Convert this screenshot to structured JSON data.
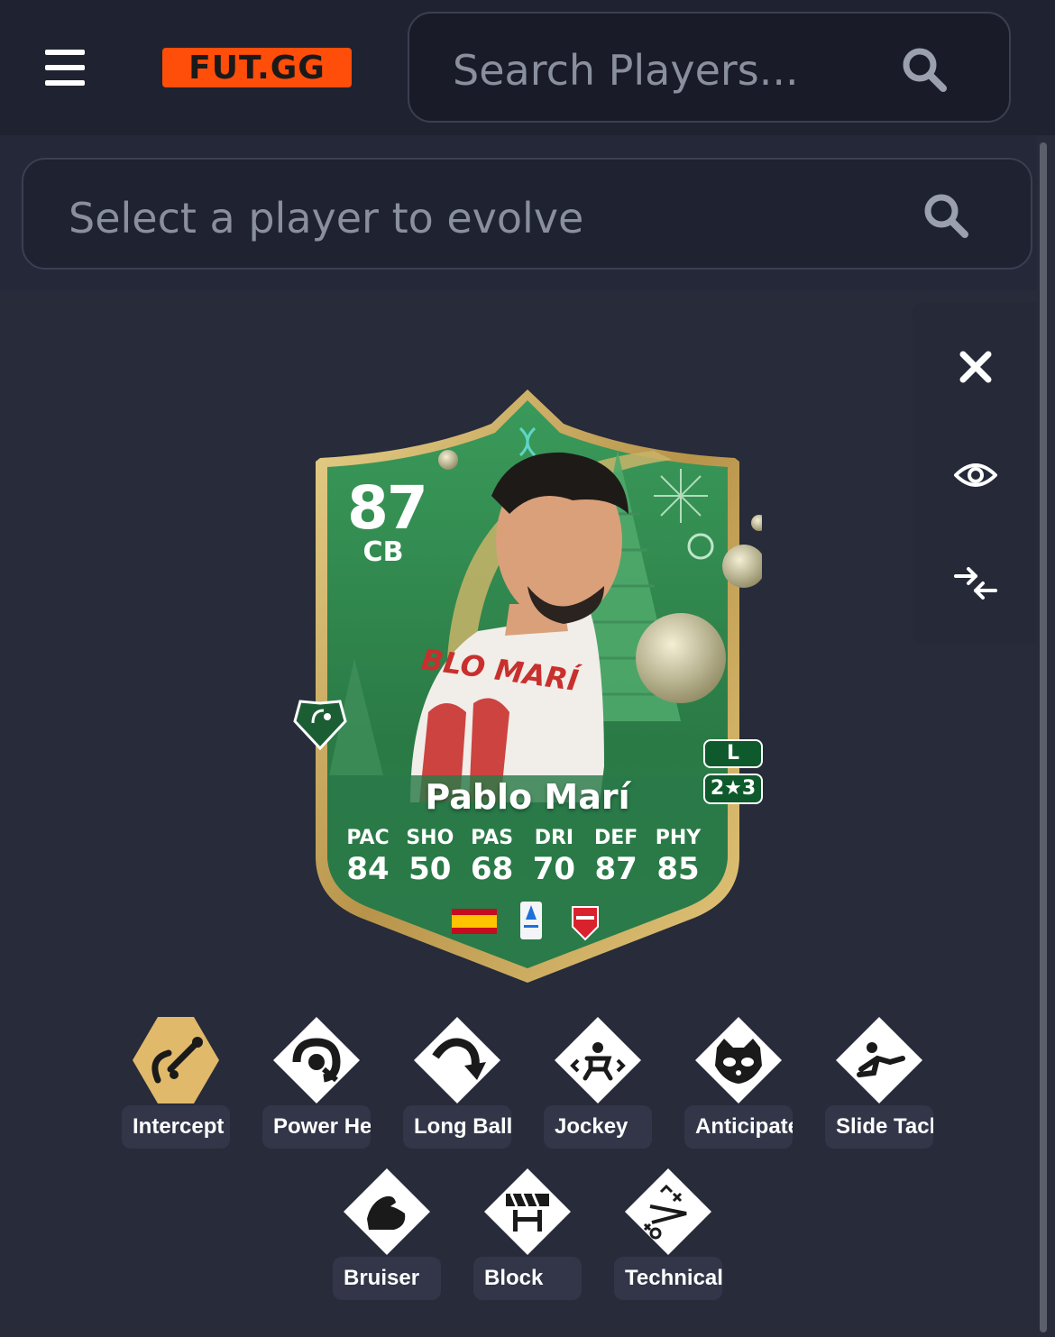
{
  "header": {
    "logo_text": "FUT.GG",
    "search_placeholder": "Search Players..."
  },
  "evolve": {
    "placeholder": "Select a player to evolve"
  },
  "side_actions": [
    {
      "icon": "close-icon"
    },
    {
      "icon": "eye-icon"
    },
    {
      "icon": "compare-arrows-icon"
    }
  ],
  "card": {
    "rating": "87",
    "position": "CB",
    "name": "Pablo Marí",
    "foot": "L",
    "skill_weak": "2★3",
    "shirt_text": "BLO MARÍ",
    "stats": [
      {
        "label": "PAC",
        "value": "84"
      },
      {
        "label": "SHO",
        "value": "50"
      },
      {
        "label": "PAS",
        "value": "68"
      },
      {
        "label": "DRI",
        "value": "70"
      },
      {
        "label": "DEF",
        "value": "87"
      },
      {
        "label": "PHY",
        "value": "85"
      }
    ],
    "colors": {
      "card_green": "#2a7a45",
      "gold": "#c9a85a"
    }
  },
  "playstyles": [
    {
      "label": "Intercept",
      "icon": "intercept-icon",
      "plus": true
    },
    {
      "label": "Power Header",
      "icon": "power-header-icon",
      "plus": false
    },
    {
      "label": "Long Ball Pass",
      "icon": "long-ball-icon",
      "plus": false
    },
    {
      "label": "Jockey",
      "icon": "jockey-icon",
      "plus": false
    },
    {
      "label": "Anticipate",
      "icon": "anticipate-icon",
      "plus": false
    },
    {
      "label": "Slide Tackle",
      "icon": "slide-tackle-icon",
      "plus": false
    },
    {
      "label": "Bruiser",
      "icon": "bruiser-icon",
      "plus": false
    },
    {
      "label": "Block",
      "icon": "block-icon",
      "plus": false
    },
    {
      "label": "Technical",
      "icon": "technical-icon",
      "plus": false
    }
  ]
}
